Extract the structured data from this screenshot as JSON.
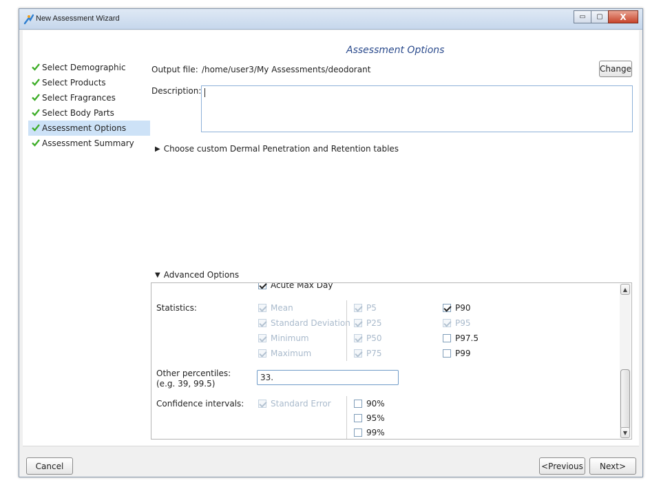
{
  "window": {
    "title": "New Assessment Wizard",
    "minimize_glyph": "▭",
    "maximize_glyph": "▢",
    "close_glyph": "X"
  },
  "page_title": "Assessment Options",
  "steps": [
    {
      "label": "Select Demographic",
      "done": true,
      "active": false
    },
    {
      "label": "Select Products",
      "done": true,
      "active": false
    },
    {
      "label": "Select Fragrances",
      "done": true,
      "active": false
    },
    {
      "label": "Select Body Parts",
      "done": true,
      "active": false
    },
    {
      "label": "Assessment Options",
      "done": true,
      "active": true
    },
    {
      "label": "Assessment Summary",
      "done": true,
      "active": false
    }
  ],
  "output_file": {
    "label": "Output file:",
    "value": "/home/user3/My Assessments/deodorant",
    "change_label": "Change"
  },
  "description": {
    "label": "Description:",
    "value": ""
  },
  "dermal_expander": {
    "label": "Choose custom Dermal Penetration and Retention tables",
    "expanded": false
  },
  "advanced_expander": {
    "label": "Advanced Options",
    "expanded": true
  },
  "advanced": {
    "acute_label": "Acute Max Day",
    "statistics_label": "Statistics:",
    "stats_col1": [
      {
        "label": "Mean",
        "checked": true,
        "enabled": false
      },
      {
        "label": "Standard Deviation",
        "checked": true,
        "enabled": false
      },
      {
        "label": "Minimum",
        "checked": true,
        "enabled": false
      },
      {
        "label": "Maximum",
        "checked": true,
        "enabled": false
      }
    ],
    "stats_col2": [
      {
        "label": "P5",
        "checked": true,
        "enabled": false
      },
      {
        "label": "P25",
        "checked": true,
        "enabled": false
      },
      {
        "label": "P50",
        "checked": true,
        "enabled": false
      },
      {
        "label": "P75",
        "checked": true,
        "enabled": false
      }
    ],
    "stats_col3": [
      {
        "label": "P90",
        "checked": true,
        "enabled": true
      },
      {
        "label": "P95",
        "checked": true,
        "enabled": false
      },
      {
        "label": "P97.5",
        "checked": false,
        "enabled": true
      },
      {
        "label": "P99",
        "checked": false,
        "enabled": true
      }
    ],
    "other_percentiles_label_1": "Other percentiles:",
    "other_percentiles_label_2": "(e.g. 39, 99.5)",
    "other_percentiles_value": "33.",
    "confidence_label": "Confidence intervals:",
    "standard_error_label": "Standard Error",
    "ci_options": [
      {
        "label": "90%",
        "checked": false
      },
      {
        "label": "95%",
        "checked": false
      },
      {
        "label": "99%",
        "checked": false
      }
    ]
  },
  "footer": {
    "cancel_label": "Cancel",
    "previous_label": "Previous",
    "next_label": "Next>"
  },
  "colors": {
    "heading": "#2a4a8c",
    "check": "#3fae2a",
    "selection": "#cde2f7"
  }
}
